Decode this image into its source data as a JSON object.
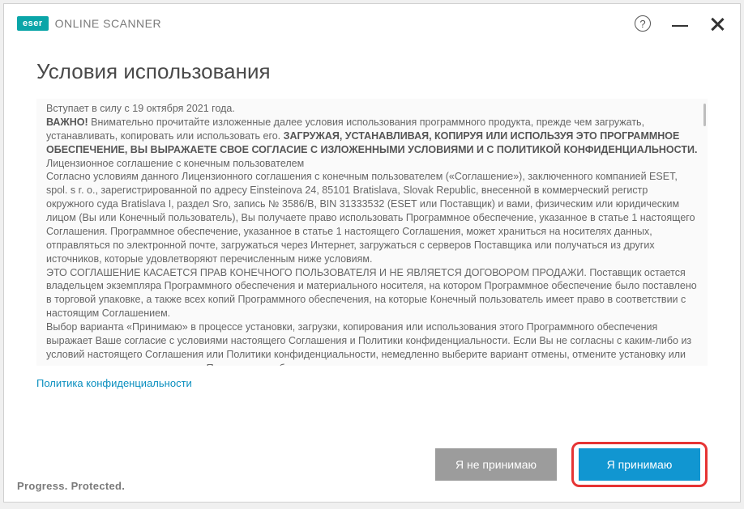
{
  "header": {
    "logo": "eser",
    "product": "ONLINE SCANNER"
  },
  "title": "Условия использования",
  "eula": {
    "effective": "Вступает в силу с 19 октября 2021 года.",
    "important_label": "ВАЖНО!",
    "important_lead": " Внимательно прочитайте изложенные далее условия использования программного продукта, прежде чем загружать, устанавливать, копировать или использовать его. ",
    "important_bold": "ЗАГРУЖАЯ, УСТАНАВЛИВАЯ, КОПИРУЯ ИЛИ ИСПОЛЬЗУЯ ЭТО ПРОГРАММНОЕ ОБЕСПЕЧЕНИЕ, ВЫ ВЫРАЖАЕТЕ СВОЕ СОГЛАСИЕ С ИЗЛОЖЕННЫМИ УСЛОВИЯМИ И С ПОЛИТИКОЙ КОНФИДЕНЦИАЛЬНОСТИ.",
    "license_heading": "Лицензионное соглашение с конечным пользователем",
    "p1": "Согласно условиям данного Лицензионного соглашения с конечным пользователем («Соглашение»), заключенного компанией ESET, spol. s r. o., зарегистрированной по адресу Einsteinova 24, 85101 Bratislava, Slovak Republic, внесенной в коммерческий регистр окружного суда Bratislava I, раздел Sro, запись № 3586/B, BIN 31333532 (ESET или Поставщик) и вами, физическим или юридическим лицом (Вы или Конечный пользователь), Вы получаете право использовать Программное обеспечение, указанное в статье 1 настоящего Соглашения. Программное обеспечение, указанное в статье 1 настоящего Соглашения, может храниться на носителях данных, отправляться по электронной почте, загружаться через Интернет, загружаться с серверов Поставщика или получаться из других источников, которые удовлетворяют перечисленным ниже условиям.",
    "p2": "ЭТО СОГЛАШЕНИЕ КАСАЕТСЯ ПРАВ КОНЕЧНОГО ПОЛЬЗОВАТЕЛЯ И НЕ ЯВЛЯЕТСЯ ДОГОВОРОМ ПРОДАЖИ. Поставщик остается владельцем экземпляра Программного обеспечения и материального носителя, на котором Программное обеспечение было поставлено в торговой упаковке, а также всех копий Программного обеспечения, на которые Конечный пользователь имеет право в соответствии с настоящим Соглашением.",
    "p3": "Выбор варианта «Принимаю» в процессе установки, загрузки, копирования или использования этого Программного обеспечения выражает Ваше согласие с условиями настоящего Соглашения и Политики конфиденциальности. Если Вы не согласны с каким-либо из условий настоящего Соглашения или Политики конфиденциальности, немедленно выберите вариант отмены, отмените установку или загрузку, уничтожьте или верните Программное обеспечение, установочные носители, сопроводительную документацию, а также квитанции об оплате Поставщику или в организацию, в которой было приобретено Программное обеспечение."
  },
  "privacy_link": "Политика конфиденциальности",
  "buttons": {
    "decline": "Я не принимаю",
    "accept": "Я принимаю"
  },
  "footer": "Progress. Protected."
}
